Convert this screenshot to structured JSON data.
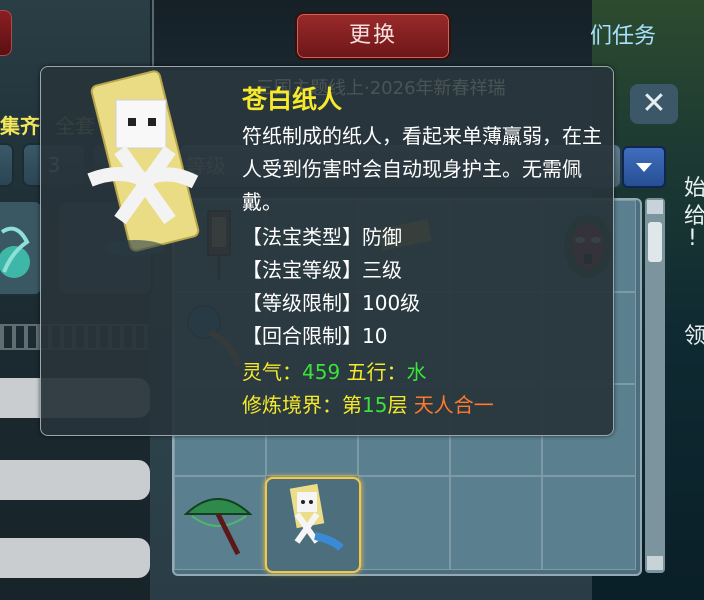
{
  "header": {
    "change_button": "更换"
  },
  "panel": {
    "set_label": "集齐",
    "set_label2": "全套",
    "level_filter_value": "3",
    "dropdown_label": "等级",
    "close_label": "✕"
  },
  "background_text": {
    "right_top": "们任务",
    "right_mid": "始",
    "right_mid2": "给",
    "right_mid3": "!",
    "right_low": "领",
    "faded_banner": "三国主题线上·2026年新春祥瑞"
  },
  "tooltip": {
    "title": "苍白纸人",
    "description": "符纸制成的纸人，看起来单薄羸弱，在主人受到伤害时会自动现身护主。无需佩戴。",
    "attributes": [
      {
        "label": "【法宝类型】",
        "value": "防御"
      },
      {
        "label": "【法宝等级】",
        "value": "三级"
      },
      {
        "label": "【等级限制】",
        "value": "100级"
      },
      {
        "label": "【回合限制】",
        "value": "10"
      }
    ],
    "spirit_label": "灵气：",
    "spirit_value": "459",
    "element_label": "五行：",
    "element_value": "水",
    "cultivation_label": "修炼境界：",
    "cultivation_prefix": "第",
    "cultivation_level": "15",
    "cultivation_suffix": "层",
    "cultivation_realm": "天人合一"
  },
  "inventory": {
    "items": [
      {
        "icon": "banner-icon"
      },
      {
        "icon": "paper-talisman-icon"
      },
      {
        "icon": "opera-mask-icon"
      },
      {
        "icon": "gourd-icon"
      },
      {
        "icon": "umbrella-icon"
      },
      {
        "icon": "paper-doll-icon",
        "selected": true
      }
    ]
  },
  "colors": {
    "title": "#f6ea2a",
    "value_green": "#3be23b",
    "realm_orange": "#ff7a2a",
    "selected_border": "#f2c84b",
    "button_red": "#9a2a2a"
  }
}
